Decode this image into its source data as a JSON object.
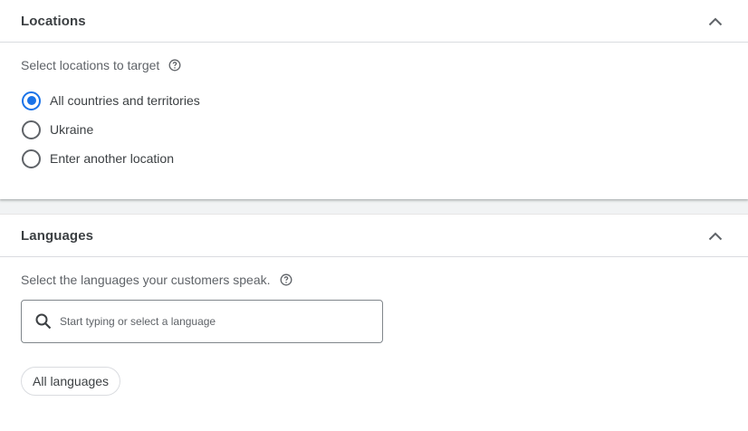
{
  "locations": {
    "title": "Locations",
    "label": "Select locations to target",
    "options": [
      {
        "label": "All countries and territories",
        "checked": true
      },
      {
        "label": "Ukraine",
        "checked": false
      },
      {
        "label": "Enter another location",
        "checked": false
      }
    ]
  },
  "languages": {
    "title": "Languages",
    "label": "Select the languages your customers speak.",
    "search_placeholder": "Start typing or select a language",
    "chip_label": "All languages"
  },
  "icons": {
    "collapse": "chevron-up-icon",
    "help": "help-circle-icon",
    "search": "search-icon"
  },
  "colors": {
    "accent": "#1a73e8",
    "text": "#3c4043",
    "secondary_text": "#5f6368",
    "divider": "#dadce0"
  }
}
